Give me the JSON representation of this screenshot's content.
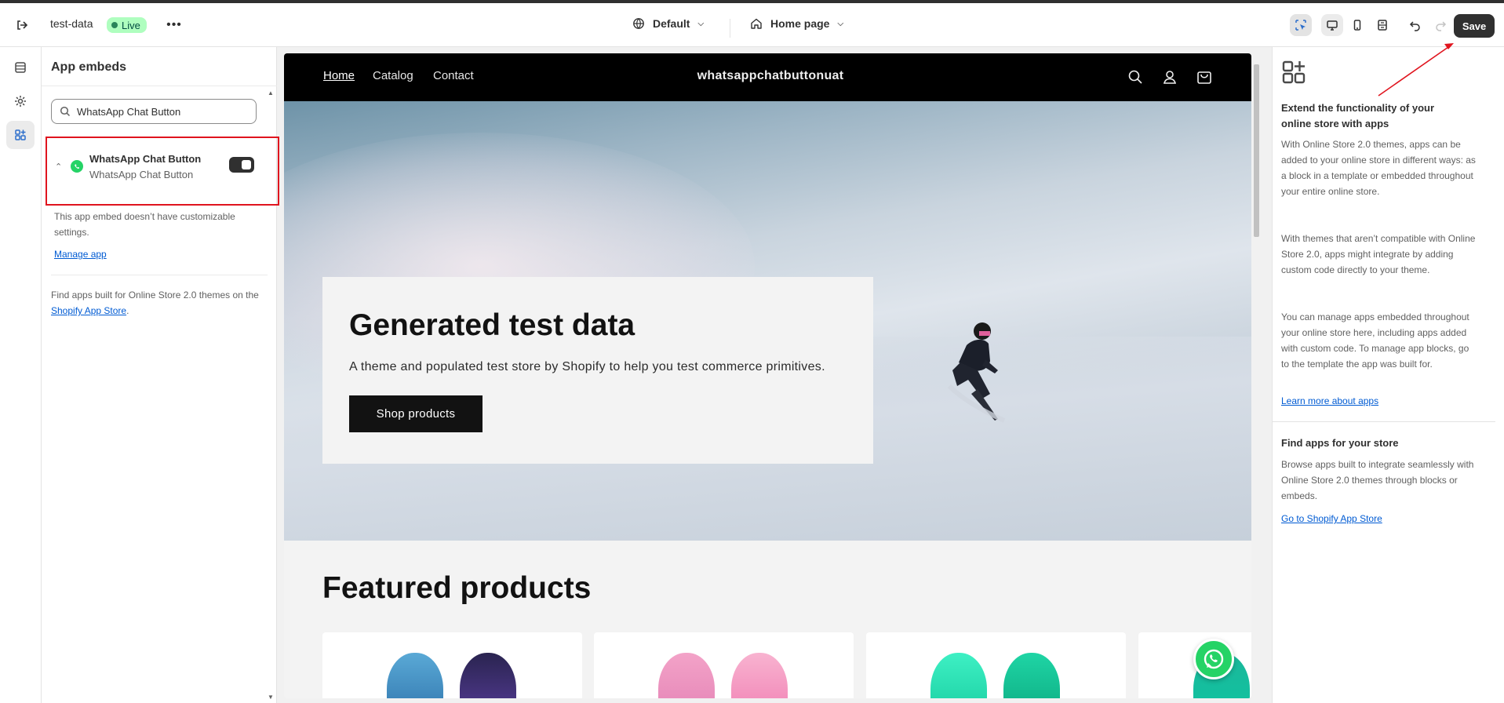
{
  "topbar": {
    "store_name": "test-data",
    "status_badge": "Live",
    "more_label": "•••",
    "theme_label": "Default",
    "page_label": "Home page",
    "save_label": "Save"
  },
  "panel": {
    "title": "App embeds",
    "search_value": "WhatsApp Chat Button",
    "embed": {
      "name": "WhatsApp Chat Button",
      "subtitle": "WhatsApp Chat Button",
      "enabled": true
    },
    "embed_note": "This app embed doesn’t have customizable settings.",
    "manage_link": "Manage app",
    "footer_text": "Find apps built for Online Store 2.0 themes on the ",
    "footer_link": "Shopify App Store",
    "footer_end": "."
  },
  "store": {
    "nav": [
      "Home",
      "Catalog",
      "Contact"
    ],
    "brand": "whatsappchatbuttonuat",
    "hero_title": "Generated test data",
    "hero_subtitle": "A theme and populated test store by Shopify to help you test commerce primitives.",
    "hero_button": "Shop products",
    "featured_title": "Featured products"
  },
  "right_panel": {
    "title": "Extend the functionality of your online store with apps",
    "para1": "With Online Store 2.0 themes, apps can be added to your online store in different ways: as a block in a template or embedded throughout your entire online store.",
    "para2": "With themes that aren’t compatible with Online Store 2.0, apps might integrate by adding custom code directly to your theme.",
    "para3": "You can manage apps embedded throughout your online store here, including apps added with custom code. To manage app blocks, go to the template the app was built for.",
    "learn_link": "Learn more about apps",
    "find_title": "Find apps for your store",
    "find_text": "Browse apps built to integrate seamlessly with Online Store 2.0 themes through blocks or embeds.",
    "store_link": "Go to Shopify App Store"
  },
  "colors": {
    "highlight_box": "#e0141e",
    "whatsapp_green": "#25d366",
    "link_blue": "#005bd3"
  }
}
